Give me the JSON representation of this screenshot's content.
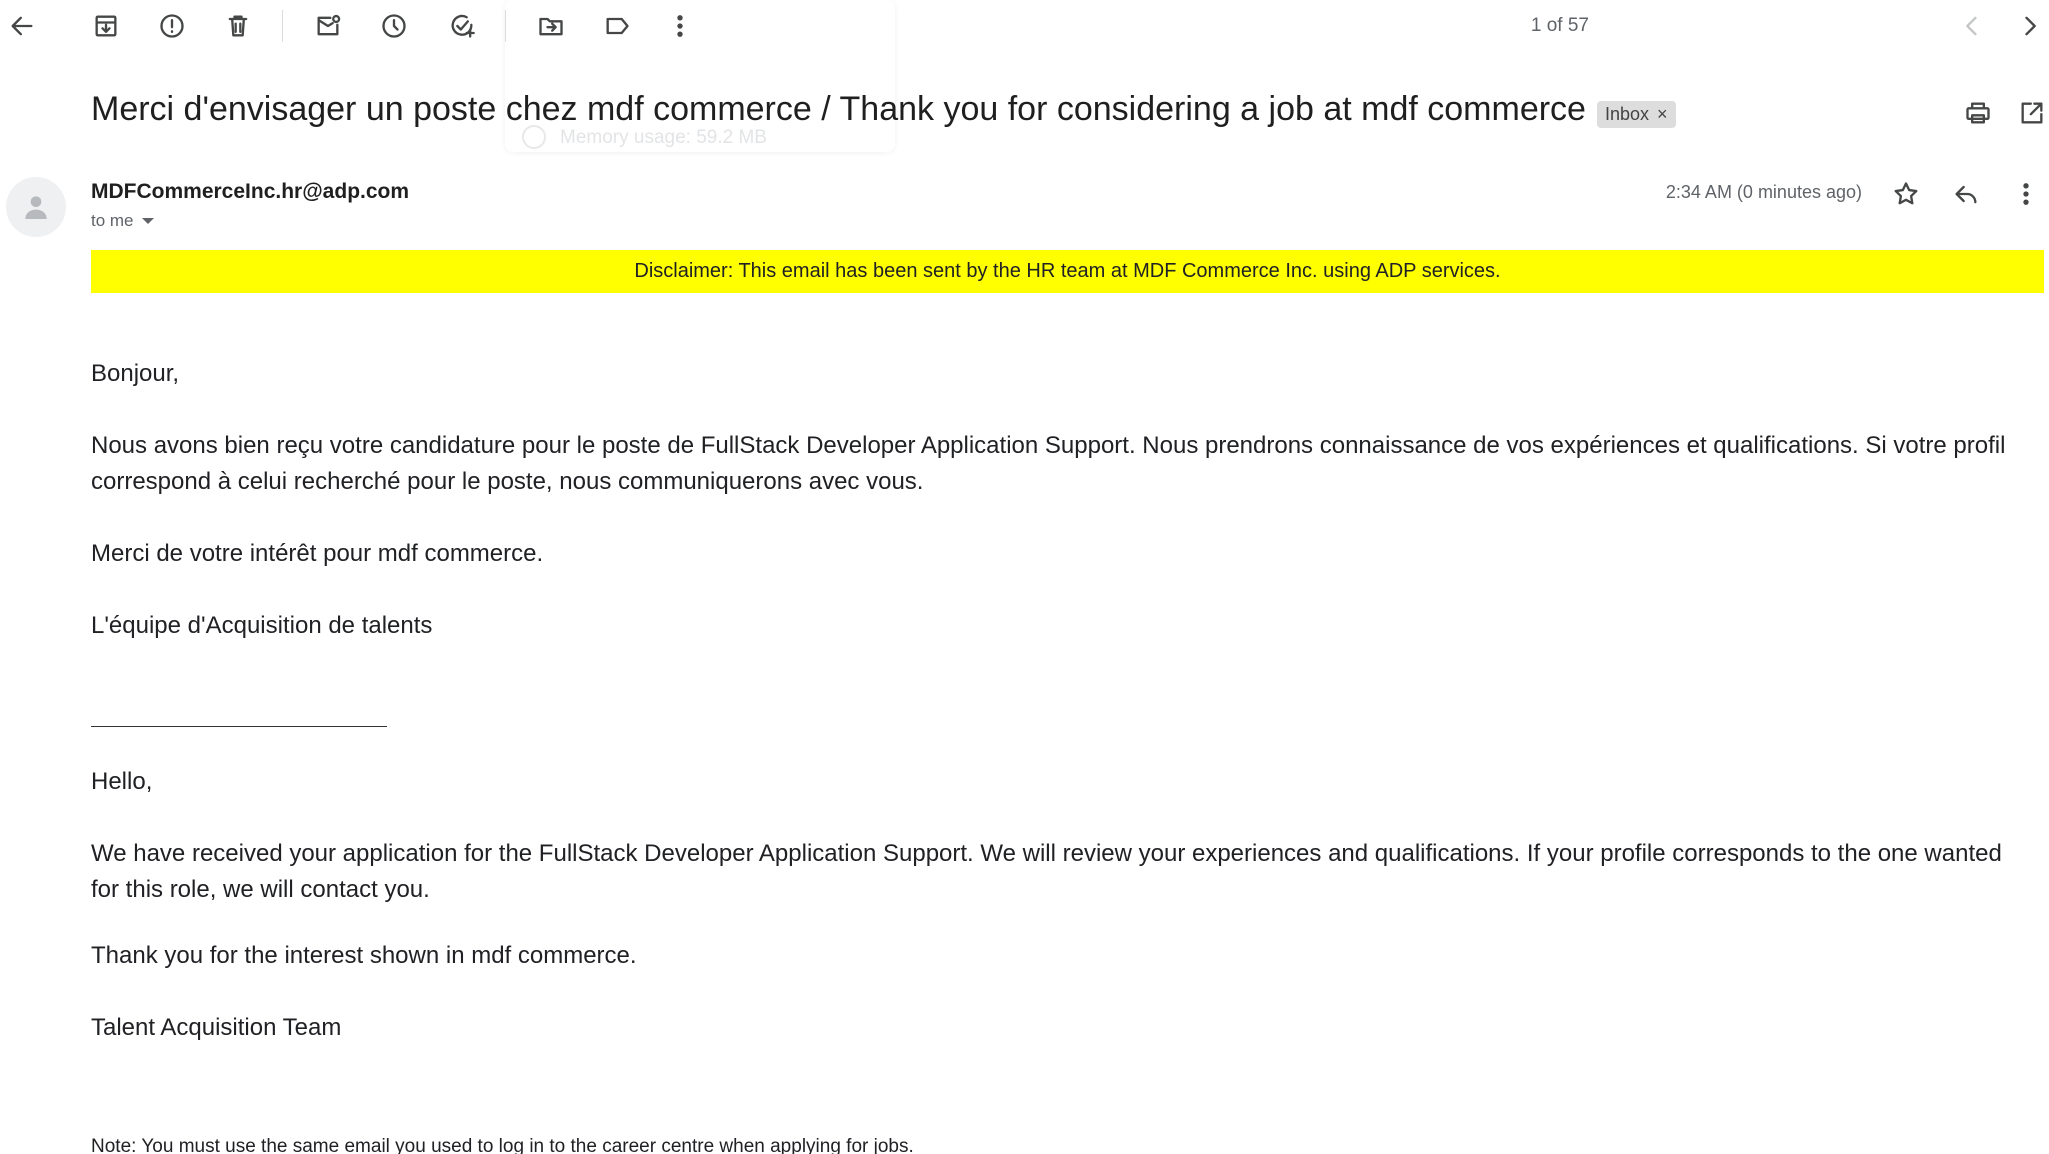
{
  "toolbar": {
    "pager_text": "1 of 57"
  },
  "overlay": {
    "memory_text": "Memory usage: 59.2 MB"
  },
  "email": {
    "subject": "Merci d'envisager un poste chez mdf commerce / Thank you for considering a job at mdf commerce",
    "label": "Inbox",
    "label_close": "×",
    "sender": "MDFCommerceInc.hr@adp.com",
    "recipient": "to me",
    "timestamp": "2:34 AM (0 minutes ago)",
    "disclaimer": "Disclaimer: This email has been sent by the HR team at MDF Commerce Inc. using ADP services.",
    "fr": {
      "greeting": "Bonjour,",
      "p1": "Nous avons bien reçu votre candidature pour le poste de FullStack Developer Application Support. Nous prendrons connaissance de vos expériences et qualifications. Si votre profil correspond à celui recherché pour le poste, nous communiquerons avec vous.",
      "p2": "Merci de votre intérêt pour mdf commerce.",
      "signature": "L'équipe d'Acquisition de talents"
    },
    "en": {
      "greeting": "Hello,",
      "p1": "We have received your application for the FullStack Developer Application Support. We will review your experiences and qualifications. If your profile corresponds to the one wanted for this role, we will contact you.",
      "p2": "Thank you for the interest shown in mdf commerce.",
      "signature": "Talent Acquisition Team"
    },
    "note": "Note: You must use the same email you used to log in to the career centre when applying for jobs."
  },
  "colors": {
    "disclaimer_bg": "#ffff00",
    "label_bg": "#dddddd"
  }
}
